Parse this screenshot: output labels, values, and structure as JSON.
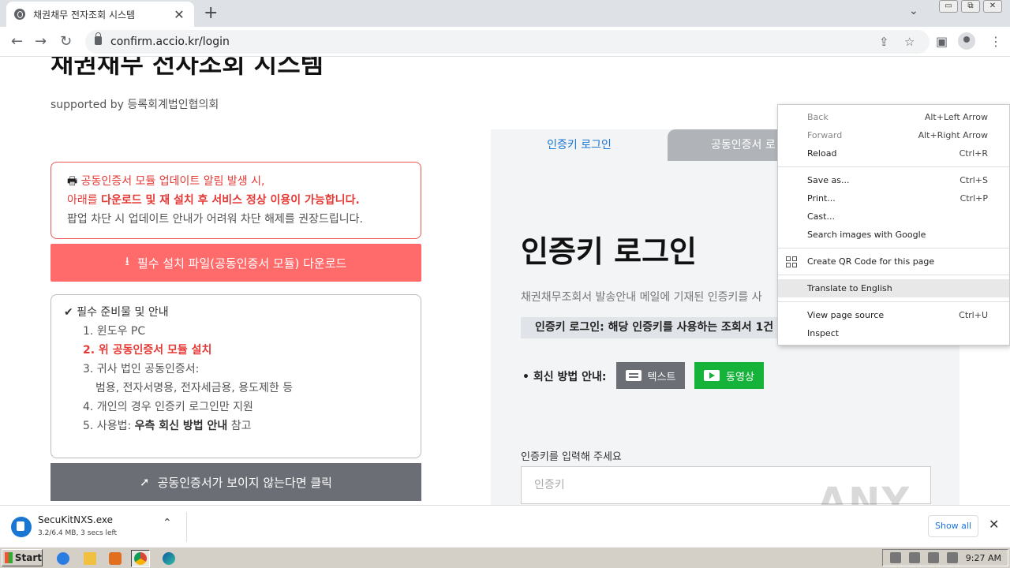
{
  "browser": {
    "tab_title": "채권채무 전자조회 시스템",
    "new_tab": "+",
    "tab_close": "✕",
    "url": "confirm.accio.kr/login",
    "window_buttons": [
      "▭",
      "⧉",
      "✕"
    ]
  },
  "page": {
    "site_title": "채권채무 전자조회 시스템",
    "supported_by": "supported by 등록회계법인협의회",
    "alert": {
      "icon": "printer-icon",
      "line1": "공동인증서 모듈 업데이트 알림 발생 시,",
      "line2_prefix": "아래를 ",
      "line2_bold": "다운로드 및 재 설치 후 서비스 정상 이용이 가능합니다.",
      "line3": "팝업 차단 시 업데이트 안내가 어려워 차단 해제를 권장드립니다."
    },
    "download_button": "필수 설치 파일(공동인증서 모듈) 다운로드",
    "prep": {
      "title": "필수 준비물 및 안내",
      "item1": "1. 윈도우 PC",
      "item2": "2. 위 공동인증서 모듈 설치",
      "item3": "3. 귀사 법인 공동인증서:",
      "item3_sub": "범용, 전자서명용, 전자세금용, 용도제한 등",
      "item4": "4. 개인의 경우 인증키 로그인만 지원",
      "item5_prefix": "5. 사용법: ",
      "item5_bold": "우측 회신 방법 안내",
      "item5_suffix": " 참고"
    },
    "cert_button": "공동인증서가 보이지 않는다면 클릭",
    "login": {
      "tab_active": "인증키 로그인",
      "tab_inactive": "공동인증서 로",
      "heading": "인증키 로그인",
      "description": "채권채무조회서 발송안내 메일에 기재된 인증키를 사",
      "strip": "인증키 로그인: 해당 인증키를 사용하는 조회서 1건",
      "reply_label": "• 회신 방법 안내:",
      "text_button": "텍스트",
      "video_button": "동영상",
      "key_label": "인증키를 입력해 주세요",
      "key_placeholder": "인증키"
    }
  },
  "context_menu": {
    "items": [
      {
        "label": "Back",
        "shortcut": "Alt+Left Arrow",
        "disabled": true
      },
      {
        "label": "Forward",
        "shortcut": "Alt+Right Arrow",
        "disabled": true
      },
      {
        "label": "Reload",
        "shortcut": "Ctrl+R"
      },
      {
        "label": "Save as...",
        "shortcut": "Ctrl+S"
      },
      {
        "label": "Print...",
        "shortcut": "Ctrl+P"
      },
      {
        "label": "Cast..."
      },
      {
        "label": "Search images with Google"
      },
      {
        "label": "Create QR Code for this page"
      },
      {
        "label": "Translate to English"
      },
      {
        "label": "View page source",
        "shortcut": "Ctrl+U"
      },
      {
        "label": "Inspect"
      }
    ]
  },
  "download_bar": {
    "file_name": "SecuKitNXS.exe",
    "status": "3.2/6.4 MB, 3 secs left",
    "show_all": "Show all",
    "close": "✕"
  },
  "watermark": "ANY RUN",
  "taskbar": {
    "start": "Start",
    "clock": "9:27 AM"
  }
}
